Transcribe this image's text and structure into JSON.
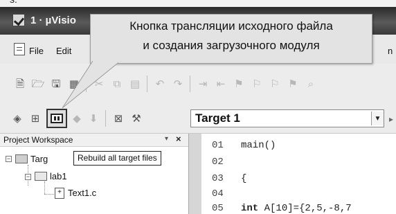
{
  "window": {
    "top_cropped_text": "s:",
    "title": "1 · µVisio"
  },
  "menu": {
    "items": [
      "File",
      "Edit"
    ],
    "right_fragment": "n"
  },
  "callout": {
    "line1": "Кнопка трансляции исходного файла",
    "line2": "и создания загрузочного модуля"
  },
  "toolbar2": {
    "target_value": "Target 1",
    "rebuild_icon": "rebuild-all-icon"
  },
  "tooltip": "Rebuild all target files",
  "project": {
    "title": "Project Workspace",
    "pin": "▾",
    "close": "×",
    "tree": {
      "root_label": "Targ",
      "group_label": "lab1",
      "file_label": "Text1.c"
    }
  },
  "editor": {
    "lines": [
      {
        "num": "01",
        "code": "main()"
      },
      {
        "num": "02",
        "code": ""
      },
      {
        "num": "03",
        "code": "{"
      },
      {
        "num": "04",
        "code": ""
      },
      {
        "num": "05",
        "kw": "int",
        "code": " A[10]={2,5,-8,7"
      }
    ]
  },
  "colors": {
    "titlebar": "#3a3a3a",
    "toolbar": "#ececec",
    "callout_bg": "#e3e3e3",
    "gutter": "#d6d6d6"
  }
}
